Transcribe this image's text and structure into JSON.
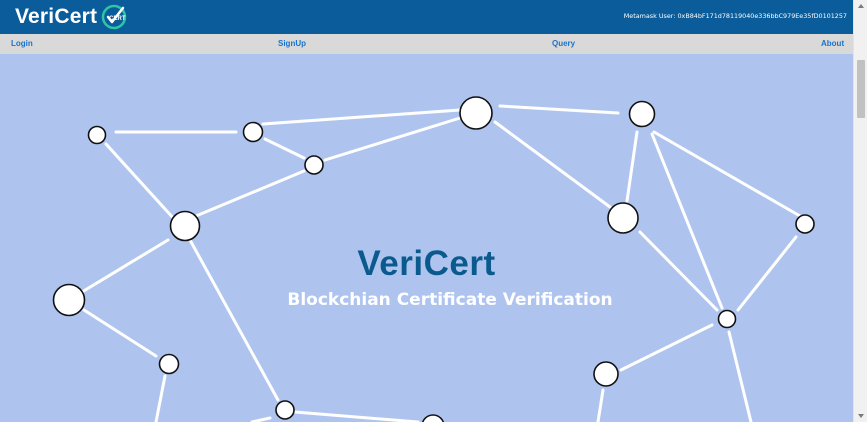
{
  "header": {
    "brand": "VeriCert",
    "logo_badge": "CERT",
    "wallet_text": "Metamask User: 0xB84bF171d78119040e336bbC979Ee35fD0101257"
  },
  "nav": {
    "items": [
      {
        "label": "Login"
      },
      {
        "label": "SignUp"
      },
      {
        "label": "Query"
      },
      {
        "label": "About"
      }
    ]
  },
  "hero": {
    "title": "VeriCert",
    "subtitle": "Blockchian Certificate Verification"
  },
  "colors": {
    "header_bg": "#0a5c9a",
    "nav_bg": "#d9d9d9",
    "nav_link": "#1a73c9",
    "hero_bg": "#aec4ef",
    "title": "#0b5a8e",
    "logo_accent": "#2ec4a6"
  },
  "icons": [
    "vericert-logo-icon",
    "network-graph-illustration",
    "scroll-up-icon",
    "scroll-down-icon"
  ]
}
